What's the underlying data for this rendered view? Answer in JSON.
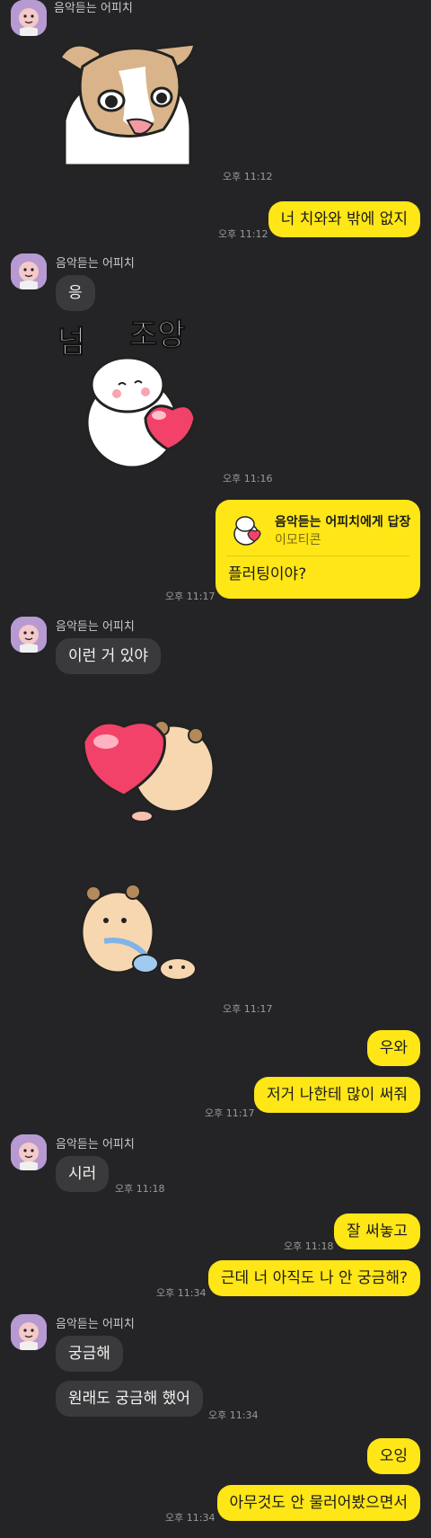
{
  "sender": {
    "name": "음악듣는 어피치"
  },
  "messages": {
    "m1_time": "오후 11:12",
    "m2_text": "너 치와와 밖에 없지",
    "m2_time": "오후 11:12",
    "m3_text": "응",
    "m4_sticker_text": "넘 조앙",
    "m4_time": "오후 11:16",
    "m5_reply_title": "음악듣는 어피치에게 답장",
    "m5_reply_sub": "이모티콘",
    "m5_text": "플러팅이야?",
    "m5_time": "오후 11:17",
    "m6_text": "이런 거 있야",
    "m7_time": "오후 11:17",
    "m8_text": "우와",
    "m9_text": "저거 나한테 많이 써줘",
    "m9_time": "오후 11:17",
    "m10_text": "시러",
    "m10_time": "오후 11:18",
    "m11_text": "잘 써놓고",
    "m11_time": "오후 11:18",
    "m12_text": "근데 너 아직도 나 안 궁금해?",
    "m12_time": "오후 11:34",
    "m13_text": "궁금해",
    "m14_text": "원래도 궁금해 했어",
    "m14_time": "오후 11:34",
    "m15_text": "오잉",
    "m16_text": "아무것도 안 물러어봤으면서",
    "m16_time": "오후 11:34"
  },
  "colors": {
    "background": "#242426",
    "bubble_in": "#3a3a3c",
    "bubble_out": "#ffe617"
  },
  "icons": {
    "avatar": "apeach-avatar",
    "sticker1": "chihuahua-sticker",
    "sticker2": "hamster-heart-sticker",
    "sticker3": "hamster-big-heart-sticker",
    "sticker4": "hamster-walk-sticker"
  }
}
